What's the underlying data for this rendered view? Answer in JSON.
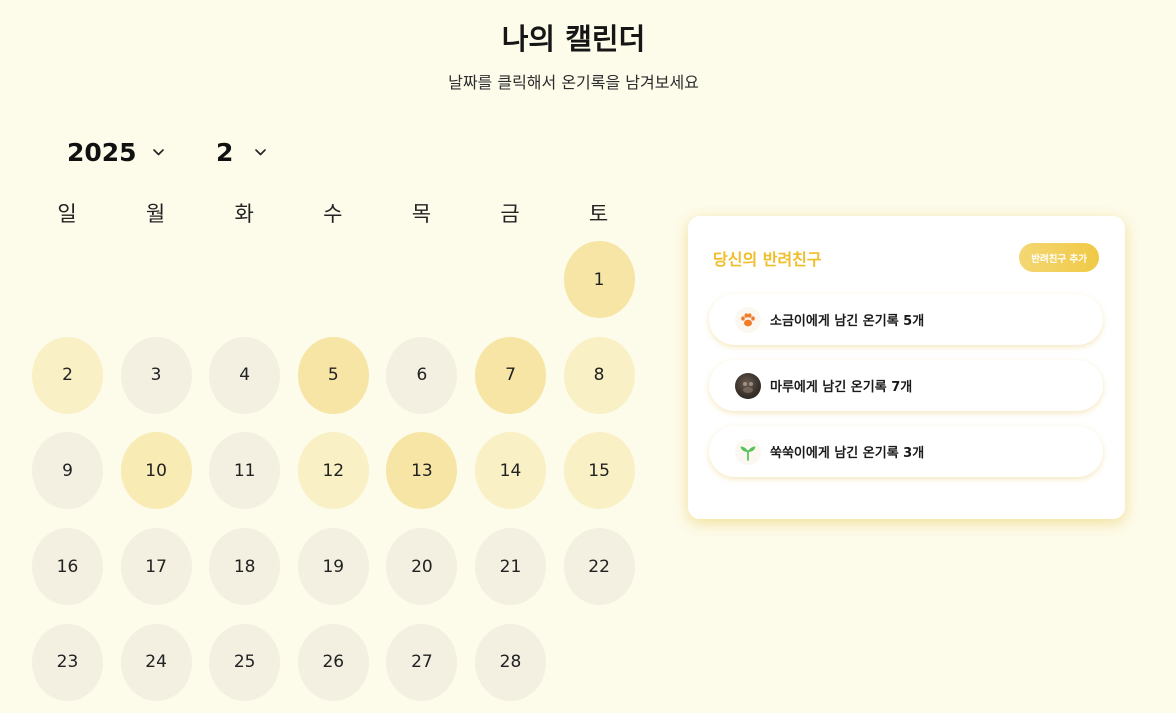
{
  "header": {
    "title": "나의 캘린더",
    "subtitle": "날짜를 클릭해서 온기록을 남겨보세요"
  },
  "selectors": {
    "year": "2025",
    "month": "2",
    "chevron_icon": "chevron-down-icon"
  },
  "calendar": {
    "weekdays": [
      "일",
      "월",
      "화",
      "수",
      "목",
      "금",
      "토"
    ],
    "first_weekday_index": 6,
    "days": [
      {
        "label": "1",
        "level": 3
      },
      {
        "label": "2",
        "level": 1
      },
      {
        "label": "3",
        "level": 0
      },
      {
        "label": "4",
        "level": 0
      },
      {
        "label": "5",
        "level": 3
      },
      {
        "label": "6",
        "level": 0
      },
      {
        "label": "7",
        "level": 3
      },
      {
        "label": "8",
        "level": 1
      },
      {
        "label": "9",
        "level": 0
      },
      {
        "label": "10",
        "level": 2
      },
      {
        "label": "11",
        "level": 0
      },
      {
        "label": "12",
        "level": 1
      },
      {
        "label": "13",
        "level": 3
      },
      {
        "label": "14",
        "level": 1
      },
      {
        "label": "15",
        "level": 1
      },
      {
        "label": "16",
        "level": 0
      },
      {
        "label": "17",
        "level": 0
      },
      {
        "label": "18",
        "level": 0
      },
      {
        "label": "19",
        "level": 0
      },
      {
        "label": "20",
        "level": 0
      },
      {
        "label": "21",
        "level": 0
      },
      {
        "label": "22",
        "level": 0
      },
      {
        "label": "23",
        "level": 0
      },
      {
        "label": "24",
        "level": 0
      },
      {
        "label": "25",
        "level": 0
      },
      {
        "label": "26",
        "level": 0
      },
      {
        "label": "27",
        "level": 0
      },
      {
        "label": "28",
        "level": 0
      }
    ]
  },
  "pet_panel": {
    "title": "당신의 반려친구",
    "add_button": "반려친구 추가",
    "pets": [
      {
        "label": "소금이에게 남긴 온기록 5개",
        "icon": "paw-icon"
      },
      {
        "label": "마루에게 남긴 온기록 7개",
        "icon": "pet-photo-avatar"
      },
      {
        "label": "쑥쑥이에게 남긴 온기록 3개",
        "icon": "sprout-icon"
      }
    ]
  },
  "colors": {
    "background": "#fdfbea",
    "accent": "#f0be2a",
    "day_empty": "#f3f0e2",
    "day_light": "#faf0c5",
    "day_medium": "#f8ebb4",
    "day_strong": "#f6e5a5",
    "paw": "#f07c2a",
    "sprout": "#58c25a"
  }
}
